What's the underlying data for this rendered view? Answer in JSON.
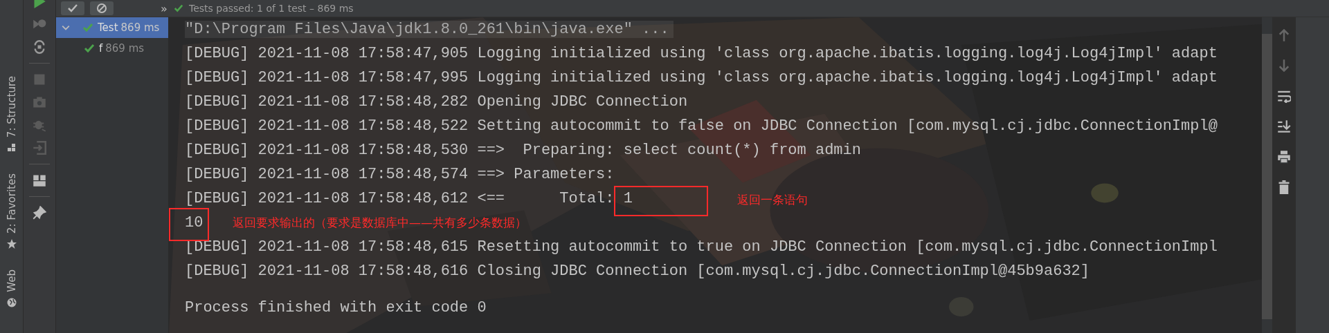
{
  "top_toolbar": {
    "more": "»"
  },
  "test_status": {
    "text": "Tests passed: 1 of 1 test – 869 ms",
    "passed": true
  },
  "tool_strip": [
    {
      "label": "7: Structure",
      "kind": "structure"
    },
    {
      "label": "2: Favorites",
      "kind": "favorites"
    },
    {
      "label": "Web",
      "kind": "web"
    }
  ],
  "test_tree": [
    {
      "name": "Test",
      "time": "869 ms",
      "selected": true,
      "passed": true,
      "expanded": true,
      "children": [
        {
          "name": "f",
          "time": "869 ms",
          "selected": false,
          "passed": true
        }
      ]
    }
  ],
  "console": {
    "lines": [
      {
        "kind": "command",
        "text": "\"D:\\Program Files\\Java\\jdk1.8.0_261\\bin\\java.exe\" ..."
      },
      {
        "kind": "log",
        "text": "[DEBUG] 2021-11-08 17:58:47,905 Logging initialized using 'class org.apache.ibatis.logging.log4j.Log4jImpl' adapt"
      },
      {
        "kind": "log",
        "text": "[DEBUG] 2021-11-08 17:58:47,995 Logging initialized using 'class org.apache.ibatis.logging.log4j.Log4jImpl' adapt"
      },
      {
        "kind": "log",
        "text": "[DEBUG] 2021-11-08 17:58:48,282 Opening JDBC Connection"
      },
      {
        "kind": "log",
        "text": "[DEBUG] 2021-11-08 17:58:48,522 Setting autocommit to false on JDBC Connection [com.mysql.cj.jdbc.ConnectionImpl@"
      },
      {
        "kind": "log",
        "text": "[DEBUG] 2021-11-08 17:58:48,530 ==>  Preparing: select count(*) from admin"
      },
      {
        "kind": "log",
        "text": "[DEBUG] 2021-11-08 17:58:48,574 ==> Parameters: "
      },
      {
        "kind": "log",
        "text": "[DEBUG] 2021-11-08 17:58:48,612 <==      Total: 1"
      },
      {
        "kind": "output",
        "text": "10"
      },
      {
        "kind": "log",
        "text": "[DEBUG] 2021-11-08 17:58:48,615 Resetting autocommit to true on JDBC Connection [com.mysql.cj.jdbc.ConnectionImpl"
      },
      {
        "kind": "log",
        "text": "[DEBUG] 2021-11-08 17:58:48,616 Closing JDBC Connection [com.mysql.cj.jdbc.ConnectionImpl@45b9a632]"
      },
      {
        "kind": "exit",
        "text": "Process finished with exit code 0"
      }
    ]
  },
  "annotations": [
    {
      "text": "返回一条语句"
    },
    {
      "text": "返回要求输出的（要求是数据库中——共有多少条数据）"
    }
  ]
}
